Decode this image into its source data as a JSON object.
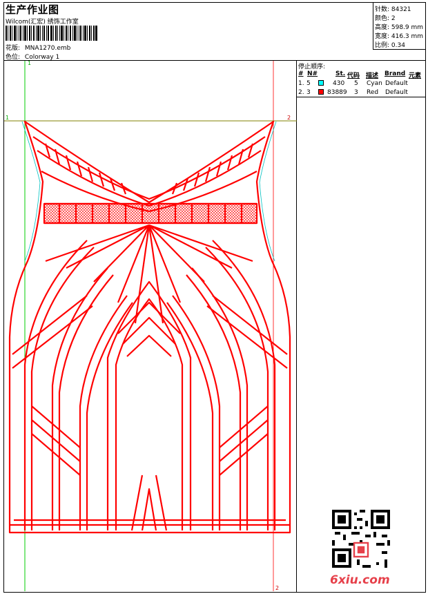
{
  "header": {
    "title": "生产作业图",
    "company": "Wilcom(汇宏) 绣饰工作室",
    "pattern_label": "花版:",
    "pattern_value": "MNA1270.emb",
    "colorway_label": "色位:",
    "colorway_value": "Colorway 1"
  },
  "stats": {
    "stitches": "针数: 84321",
    "colors": "颜色: 2",
    "height": "高度: 598.9 mm",
    "width": "宽度: 416.3 mm",
    "scale": "比例: 0.34"
  },
  "stop_sequence": {
    "title": "停止顺序:",
    "headers": [
      "#",
      "N#",
      "St.",
      "代码",
      "描述",
      "Brand",
      "元素"
    ],
    "rows": [
      {
        "index": "1.",
        "n": "5",
        "color": "#00ffff",
        "stitches": "430",
        "code": "5",
        "desc": "Cyan",
        "brand": "Default"
      },
      {
        "index": "2.",
        "n": "3",
        "color": "#ff0000",
        "stitches": "83889",
        "code": "3",
        "desc": "Red",
        "brand": "Default"
      }
    ]
  },
  "guides": {
    "v1_top": "1",
    "h1_left": "1",
    "h2_right": "2",
    "v2_bottom": "2"
  },
  "watermark": "6xiu.com",
  "colors": {
    "design_red": "#ff0000",
    "guide_green": "#00cc00",
    "guide_olive": "#808000",
    "outline_cyan": "#00c0c0"
  }
}
